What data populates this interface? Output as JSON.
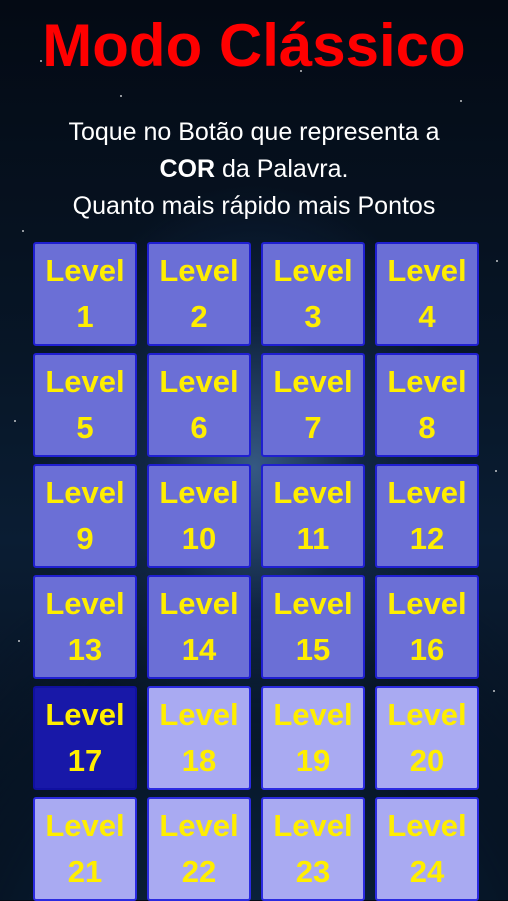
{
  "title": "Modo Clássico",
  "instructions": {
    "line1": "Toque no Botão que representa a",
    "line2_bold": "COR",
    "line2_rest": " da Palavra.",
    "line3": "Quanto mais rápido mais Pontos"
  },
  "colors": {
    "title": "#ff0000",
    "level_text": "#ffee00",
    "unlocked_bg": "#6b6fd6",
    "current_bg": "#1818a8",
    "locked_bg": "#a9aaf2"
  },
  "levels": [
    {
      "label": "Level",
      "number": "1",
      "state": "unlocked"
    },
    {
      "label": "Level",
      "number": "2",
      "state": "unlocked"
    },
    {
      "label": "Level",
      "number": "3",
      "state": "unlocked"
    },
    {
      "label": "Level",
      "number": "4",
      "state": "unlocked"
    },
    {
      "label": "Level",
      "number": "5",
      "state": "unlocked"
    },
    {
      "label": "Level",
      "number": "6",
      "state": "unlocked"
    },
    {
      "label": "Level",
      "number": "7",
      "state": "unlocked"
    },
    {
      "label": "Level",
      "number": "8",
      "state": "unlocked"
    },
    {
      "label": "Level",
      "number": "9",
      "state": "unlocked"
    },
    {
      "label": "Level",
      "number": "10",
      "state": "unlocked"
    },
    {
      "label": "Level",
      "number": "11",
      "state": "unlocked"
    },
    {
      "label": "Level",
      "number": "12",
      "state": "unlocked"
    },
    {
      "label": "Level",
      "number": "13",
      "state": "unlocked"
    },
    {
      "label": "Level",
      "number": "14",
      "state": "unlocked"
    },
    {
      "label": "Level",
      "number": "15",
      "state": "unlocked"
    },
    {
      "label": "Level",
      "number": "16",
      "state": "unlocked"
    },
    {
      "label": "Level",
      "number": "17",
      "state": "current"
    },
    {
      "label": "Level",
      "number": "18",
      "state": "locked"
    },
    {
      "label": "Level",
      "number": "19",
      "state": "locked"
    },
    {
      "label": "Level",
      "number": "20",
      "state": "locked"
    },
    {
      "label": "Level",
      "number": "21",
      "state": "locked"
    },
    {
      "label": "Level",
      "number": "22",
      "state": "locked"
    },
    {
      "label": "Level",
      "number": "23",
      "state": "locked"
    },
    {
      "label": "Level",
      "number": "24",
      "state": "locked"
    }
  ]
}
